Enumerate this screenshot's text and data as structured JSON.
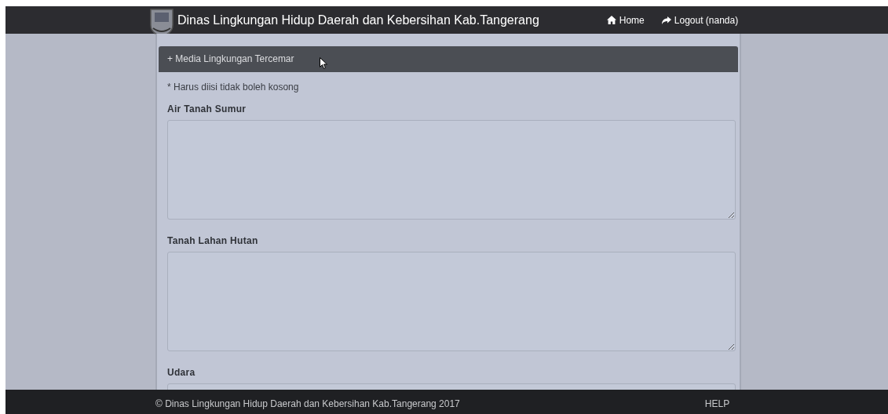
{
  "navbar": {
    "title": "Dinas Lingkungan Hidup Daerah dan Kebersihan Kab.Tangerang",
    "links": [
      {
        "label": "Home"
      },
      {
        "label": "Logout (nanda)"
      }
    ]
  },
  "panel": {
    "title": "+ Media Lingkungan Tercemar",
    "note": "* Harus diisi tidak boleh kosong",
    "fields": [
      {
        "label": "Air Tanah Sumur"
      },
      {
        "label": "Tanah Lahan Hutan"
      },
      {
        "label": "Udara"
      }
    ]
  },
  "footer": {
    "text": "© Dinas Lingkungan Hidup Daerah dan Kebersihan Kab.Tangerang 2017",
    "help": "HELP"
  }
}
